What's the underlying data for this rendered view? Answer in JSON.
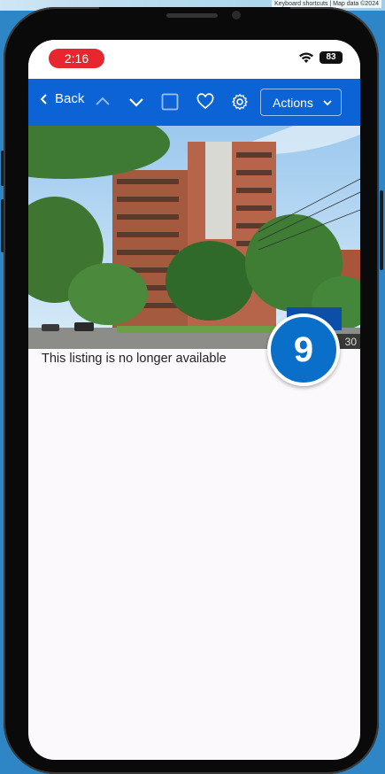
{
  "map": {
    "attribution": "Keyboard shortcuts | Map data ©2024"
  },
  "status_bar": {
    "time": "2:16",
    "battery": "83"
  },
  "toolbar": {
    "back_label": "Back",
    "actions_label": "Actions"
  },
  "listing": {
    "photo_counter": "30",
    "unavailable_message": "This listing is no longer available"
  },
  "overlay": {
    "step_number": "9"
  },
  "colors": {
    "toolbar_blue": "#0c63d5",
    "time_pill_red": "#e8262f",
    "badge_blue": "#0a6fc8"
  }
}
